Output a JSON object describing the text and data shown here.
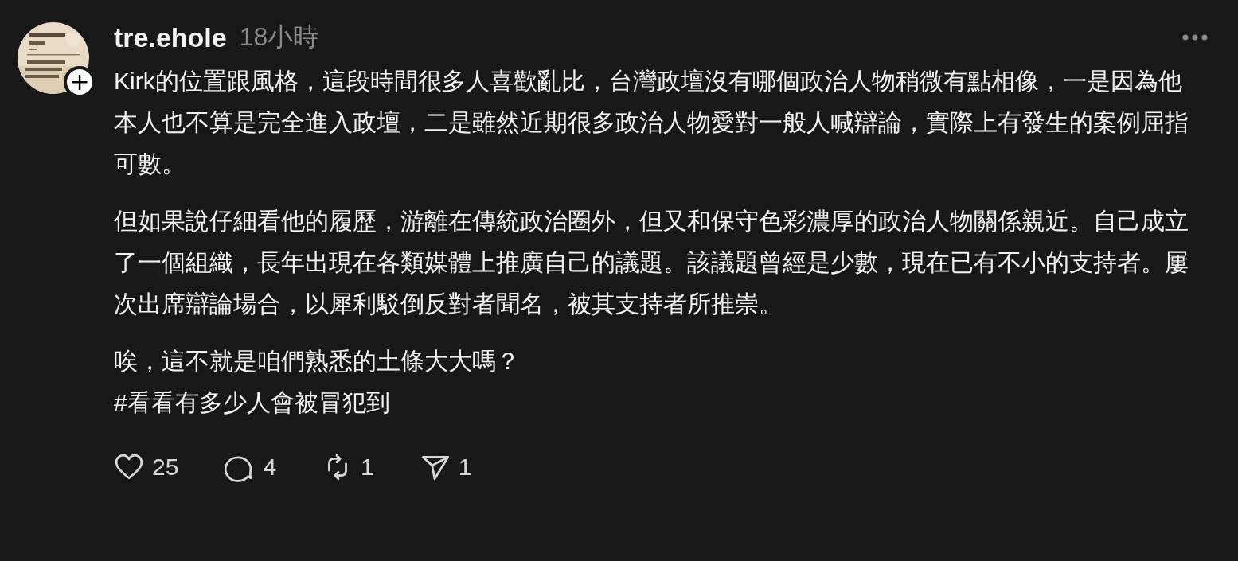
{
  "post": {
    "author": {
      "username": "tre.ehole",
      "follow_badge": "+"
    },
    "time": "18小時",
    "body": [
      "Kirk的位置跟風格，這段時間很多人喜歡亂比，台灣政壇沒有哪個政治人物稍微有點相像，一是因為他本人也不算是完全進入政壇，二是雖然近期很多政治人物愛對一般人喊辯論，實際上有發生的案例屈指可數。",
      "但如果說仔細看他的履歷，游離在傳統政治圈外，但又和保守色彩濃厚的政治人物關係親近。自己成立了一個組織，長年出現在各類媒體上推廣自己的議題。該議題曾經是少數，現在已有不小的支持者。屢次出席辯論場合，以犀利駁倒反對者聞名，被其支持者所推崇。",
      "唉，這不就是咱們熟悉的土條大大嗎？\n#看看有多少人會被冒犯到"
    ],
    "actions": [
      {
        "kind": "like",
        "count": "25"
      },
      {
        "kind": "reply",
        "count": "4"
      },
      {
        "kind": "repost",
        "count": "1"
      },
      {
        "kind": "share",
        "count": "1"
      }
    ]
  }
}
